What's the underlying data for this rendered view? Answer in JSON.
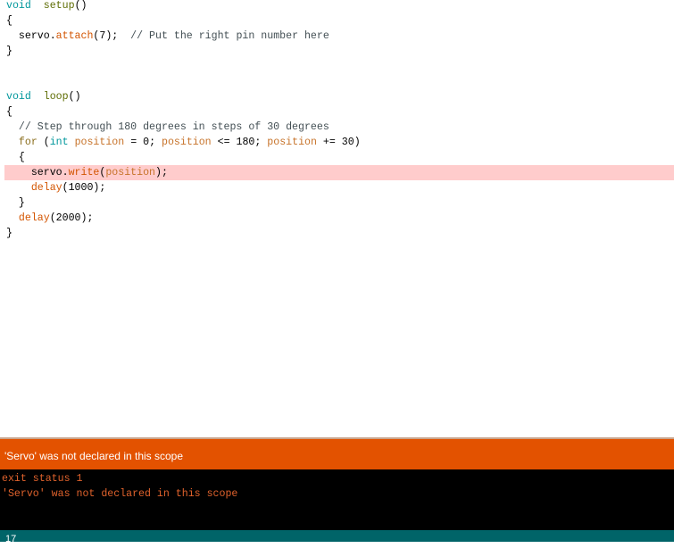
{
  "editor": {
    "highlight_line": 11,
    "lines": [
      [
        [
          "kw",
          "void"
        ],
        [
          "",
          "  "
        ],
        [
          "fn",
          "setup"
        ],
        [
          "",
          "()"
        ]
      ],
      [
        [
          "",
          "{"
        ]
      ],
      [
        [
          "",
          "  servo."
        ],
        [
          "lib",
          "attach"
        ],
        [
          "",
          "(7);  "
        ],
        [
          "cm",
          "// Put the right pin number here"
        ]
      ],
      [
        [
          "",
          "}"
        ]
      ],
      [],
      [],
      [
        [
          "kw",
          "void"
        ],
        [
          "",
          "  "
        ],
        [
          "fn",
          "loop"
        ],
        [
          "",
          "()"
        ]
      ],
      [
        [
          "",
          "{"
        ]
      ],
      [
        [
          "",
          "  "
        ],
        [
          "cm",
          "// Step through 180 degrees in steps of 30 degrees"
        ]
      ],
      [
        [
          "",
          "  "
        ],
        [
          "ctl",
          "for"
        ],
        [
          "",
          " ("
        ],
        [
          "kw",
          "int"
        ],
        [
          "",
          " "
        ],
        [
          "var",
          "position"
        ],
        [
          "",
          " = 0; "
        ],
        [
          "var",
          "position"
        ],
        [
          "",
          " <= 180; "
        ],
        [
          "var",
          "position"
        ],
        [
          "",
          " += 30)"
        ]
      ],
      [
        [
          "",
          "  {"
        ]
      ],
      [
        [
          "",
          "    servo."
        ],
        [
          "lib",
          "write"
        ],
        [
          "",
          "("
        ],
        [
          "var",
          "position"
        ],
        [
          "",
          ");"
        ]
      ],
      [
        [
          "",
          "    "
        ],
        [
          "lib",
          "delay"
        ],
        [
          "",
          "(1000);"
        ]
      ],
      [
        [
          "",
          "  }"
        ]
      ],
      [
        [
          "",
          "  "
        ],
        [
          "lib",
          "delay"
        ],
        [
          "",
          "(2000);"
        ]
      ],
      [
        [
          "",
          "}"
        ]
      ]
    ]
  },
  "error_bar": {
    "message": "'Servo' was not declared in this scope"
  },
  "console": {
    "line1": "exit status 1",
    "line2": "'Servo' was not declared in this scope"
  },
  "status": {
    "line_number": "17"
  }
}
